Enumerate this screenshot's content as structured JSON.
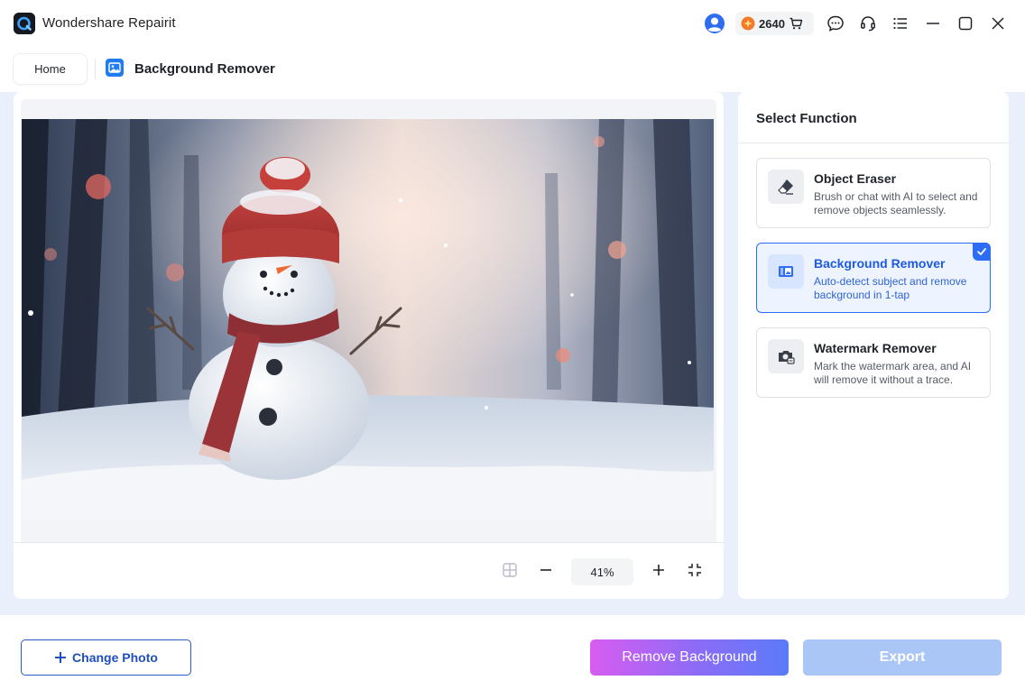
{
  "app": {
    "title": "Wondershare Repairit"
  },
  "titlebar": {
    "credits": "2640",
    "icons": [
      "user-avatar-icon",
      "coin-icon",
      "cart-icon",
      "chat-icon",
      "headset-icon",
      "menu-icon",
      "minimize-icon",
      "maximize-icon",
      "close-icon"
    ]
  },
  "tabs": {
    "home": "Home",
    "current": "Background Remover"
  },
  "canvas": {
    "image_alt": "Snowman with red knit hat and scarf in a snowy forest",
    "zoom": "41%"
  },
  "function_panel": {
    "header": "Select Function",
    "items": [
      {
        "title": "Object Eraser",
        "description": "Brush or chat with AI to select and remove objects seamlessly.",
        "icon": "eraser-icon",
        "selected": false
      },
      {
        "title": "Background Remover",
        "description": "Auto-detect subject and remove background in 1-tap",
        "icon": "background-remover-icon",
        "selected": true
      },
      {
        "title": "Watermark Remover",
        "description": "Mark the watermark area, and AI will remove it without a trace.",
        "icon": "watermark-remover-icon",
        "selected": false
      }
    ]
  },
  "footer": {
    "change_photo": "Change Photo",
    "remove_background": "Remove Background",
    "export": "Export"
  },
  "colors": {
    "accent": "#2d6df6",
    "main_bg": "#e9f0fb",
    "export_disabled": "#a9c6f7"
  }
}
